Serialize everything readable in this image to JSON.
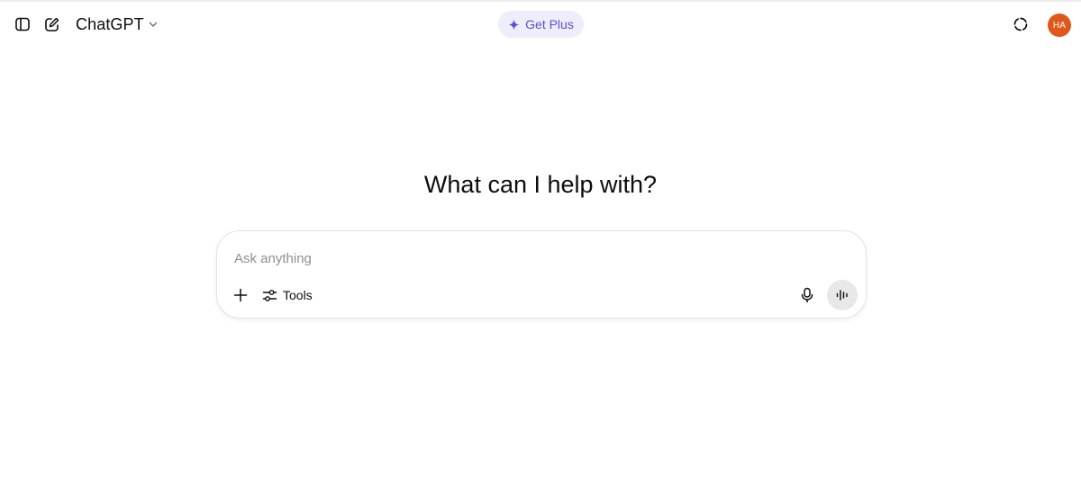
{
  "header": {
    "model_name": "ChatGPT",
    "get_plus_label": "Get Plus",
    "avatar_initials": "HA"
  },
  "main": {
    "headline": "What can I help with?"
  },
  "composer": {
    "placeholder": "Ask anything",
    "value": "",
    "tools_label": "Tools"
  },
  "icons": {
    "sidebar_toggle": "sidebar-toggle-icon",
    "new_chat": "compose-icon",
    "model_dropdown": "chevron-down-icon",
    "get_plus": "sparkle-icon",
    "temporary_chat": "dashed-circle-icon",
    "attach": "plus-icon",
    "tools": "sliders-icon",
    "dictate": "microphone-icon",
    "voice_mode": "waveform-icon"
  },
  "colors": {
    "accent": "#5b4fd6",
    "get_plus_bg": "#eeedfa",
    "avatar_bg": "#e0571b",
    "voice_button_bg": "#e8e8e8"
  }
}
